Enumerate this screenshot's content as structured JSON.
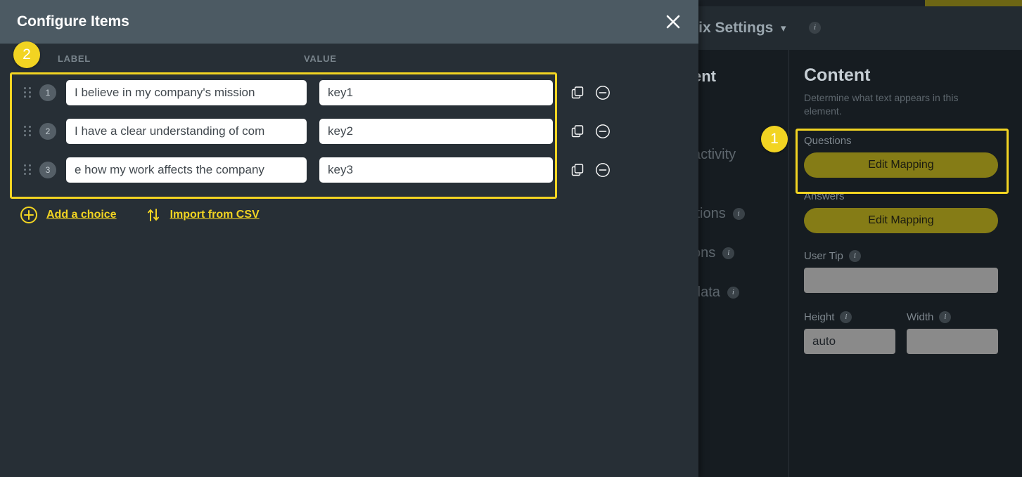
{
  "background": {
    "header": {
      "title": "rix Settings",
      "chevron_icon": "chevron-down-icon",
      "info_icon": "info-icon"
    },
    "nav_heading": "ent",
    "nav_items": [
      {
        "label": "activity",
        "has_info": false
      },
      {
        "label": "itions",
        "has_info": true
      },
      {
        "label": "ons",
        "has_info": true
      },
      {
        "label": "data",
        "has_info": true
      }
    ]
  },
  "panel": {
    "title": "Content",
    "description": "Determine what text appears in this element.",
    "questions": {
      "label": "Questions",
      "button_label": "Edit Mapping"
    },
    "answers": {
      "label": "Answers",
      "button_label": "Edit Mapping"
    },
    "user_tip": {
      "label": "User Tip",
      "value": "",
      "info_icon": "info-icon"
    },
    "height": {
      "label": "Height",
      "value": "auto",
      "info_icon": "info-icon"
    },
    "width": {
      "label": "Width",
      "value": "",
      "info_icon": "info-icon"
    }
  },
  "modal": {
    "title": "Configure Items",
    "close_icon": "close-icon",
    "columns": {
      "label": "LABEL",
      "value": "VALUE"
    },
    "rows": [
      {
        "index": "1",
        "label": "I believe in my company's mission",
        "value": "key1",
        "duplicate_icon": "copy-icon",
        "remove_icon": "minus-circle-icon"
      },
      {
        "index": "2",
        "label": "I have a clear understanding of com",
        "value": "key2",
        "duplicate_icon": "copy-icon",
        "remove_icon": "minus-circle-icon"
      },
      {
        "index": "3",
        "label": "e how my work affects the company",
        "value": "key3",
        "duplicate_icon": "copy-icon",
        "remove_icon": "minus-circle-icon"
      }
    ],
    "add_choice": {
      "label": "Add a choice",
      "icon": "plus-circle-icon"
    },
    "import_csv": {
      "label": "Import from CSV",
      "icon": "sort-arrows-icon"
    }
  },
  "annotations": {
    "step_one": "1",
    "step_two": "2",
    "highlight_color": "#f2d422"
  }
}
